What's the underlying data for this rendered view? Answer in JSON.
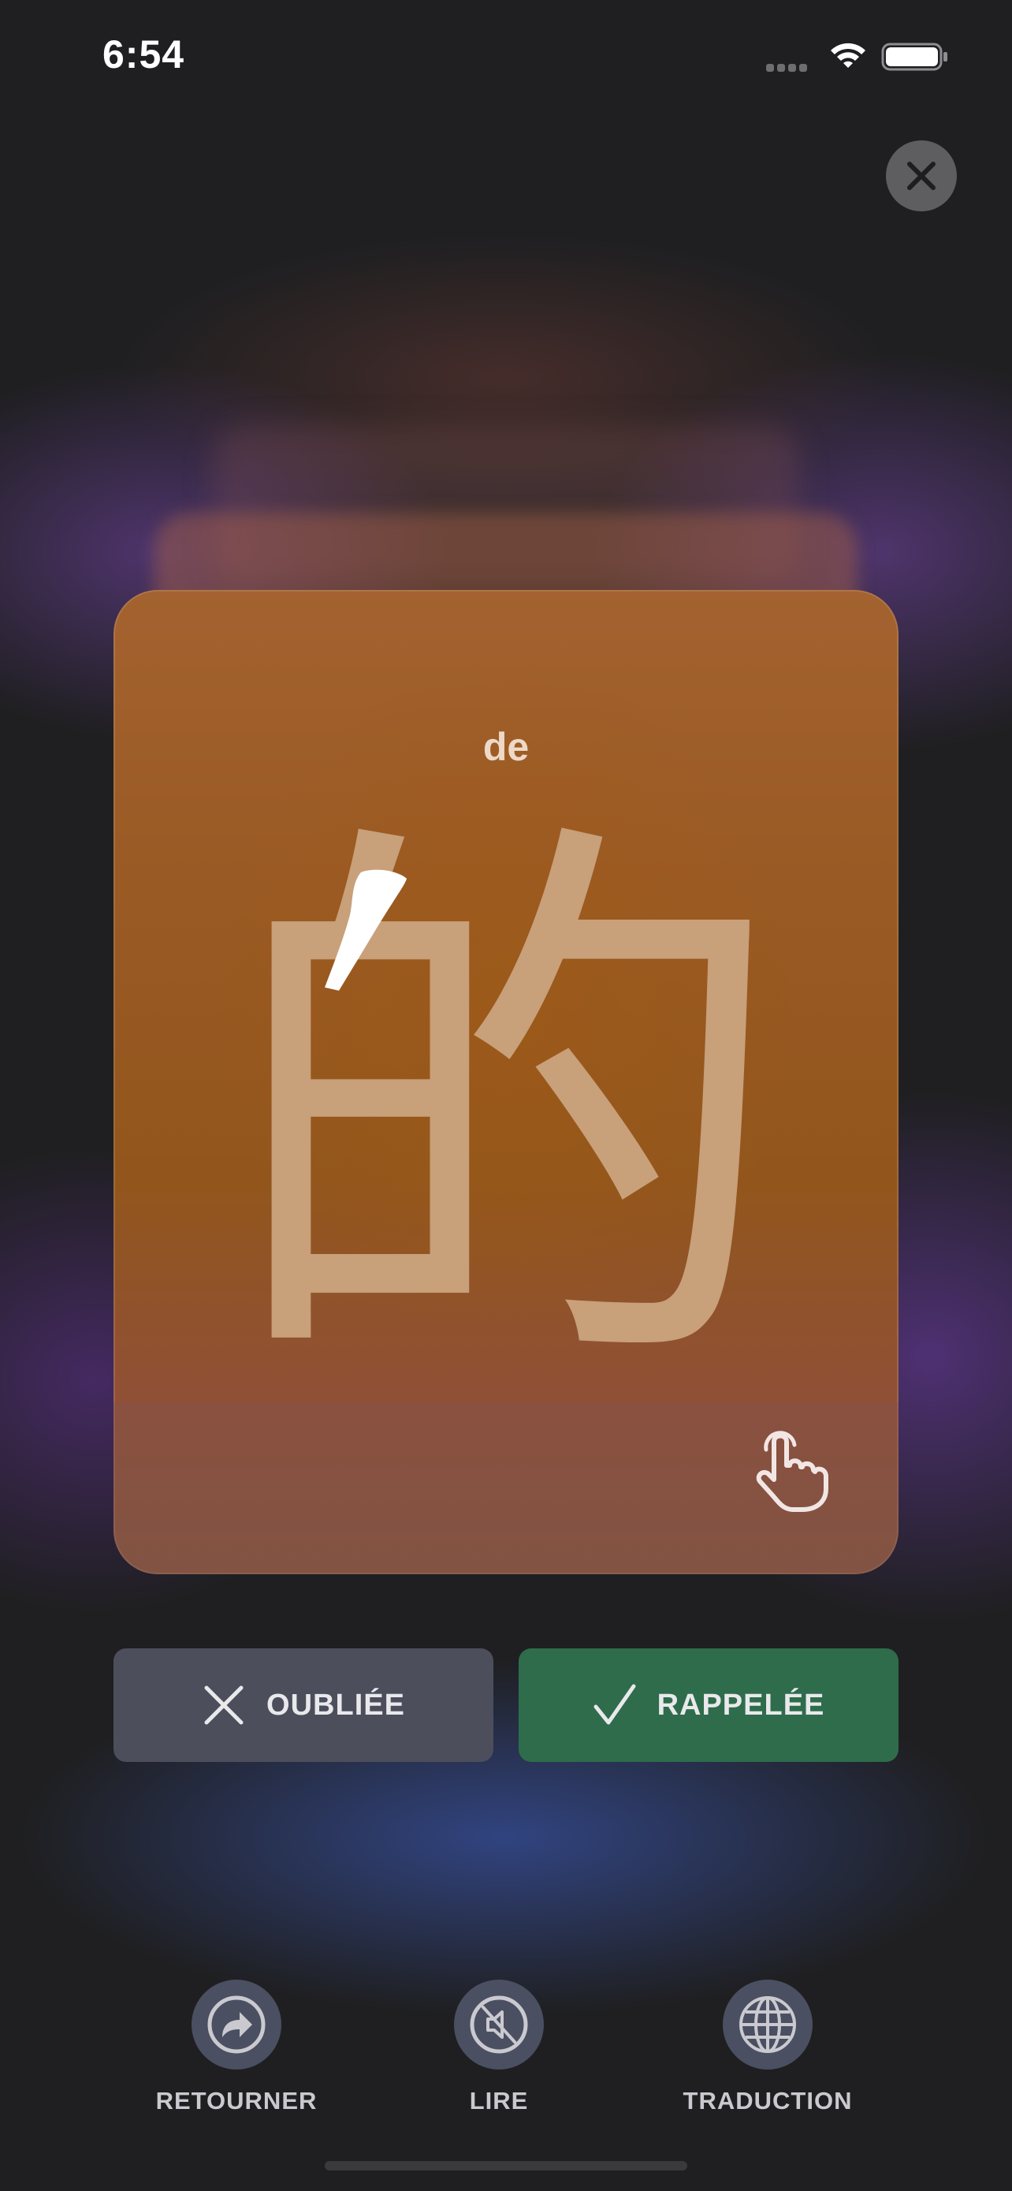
{
  "status_bar": {
    "time": "6:54"
  },
  "card": {
    "pinyin": "de",
    "character": "的"
  },
  "answers": {
    "forgot_label": "OUBLIÉE",
    "remembered_label": "RAPPELÉE"
  },
  "toolbar": {
    "items": [
      {
        "label": "RETOURNER",
        "icon": "flip-arrow-icon"
      },
      {
        "label": "LIRE",
        "icon": "speaker-muted-icon"
      },
      {
        "label": "TRADUCTION",
        "icon": "globe-icon"
      }
    ]
  },
  "colors": {
    "card": "#9a5a24",
    "character": "#c8a07a",
    "forgot_button": "#4c4e5c",
    "remembered_button": "#2e6c4c",
    "toolbar_circle": "#4b4f62"
  }
}
